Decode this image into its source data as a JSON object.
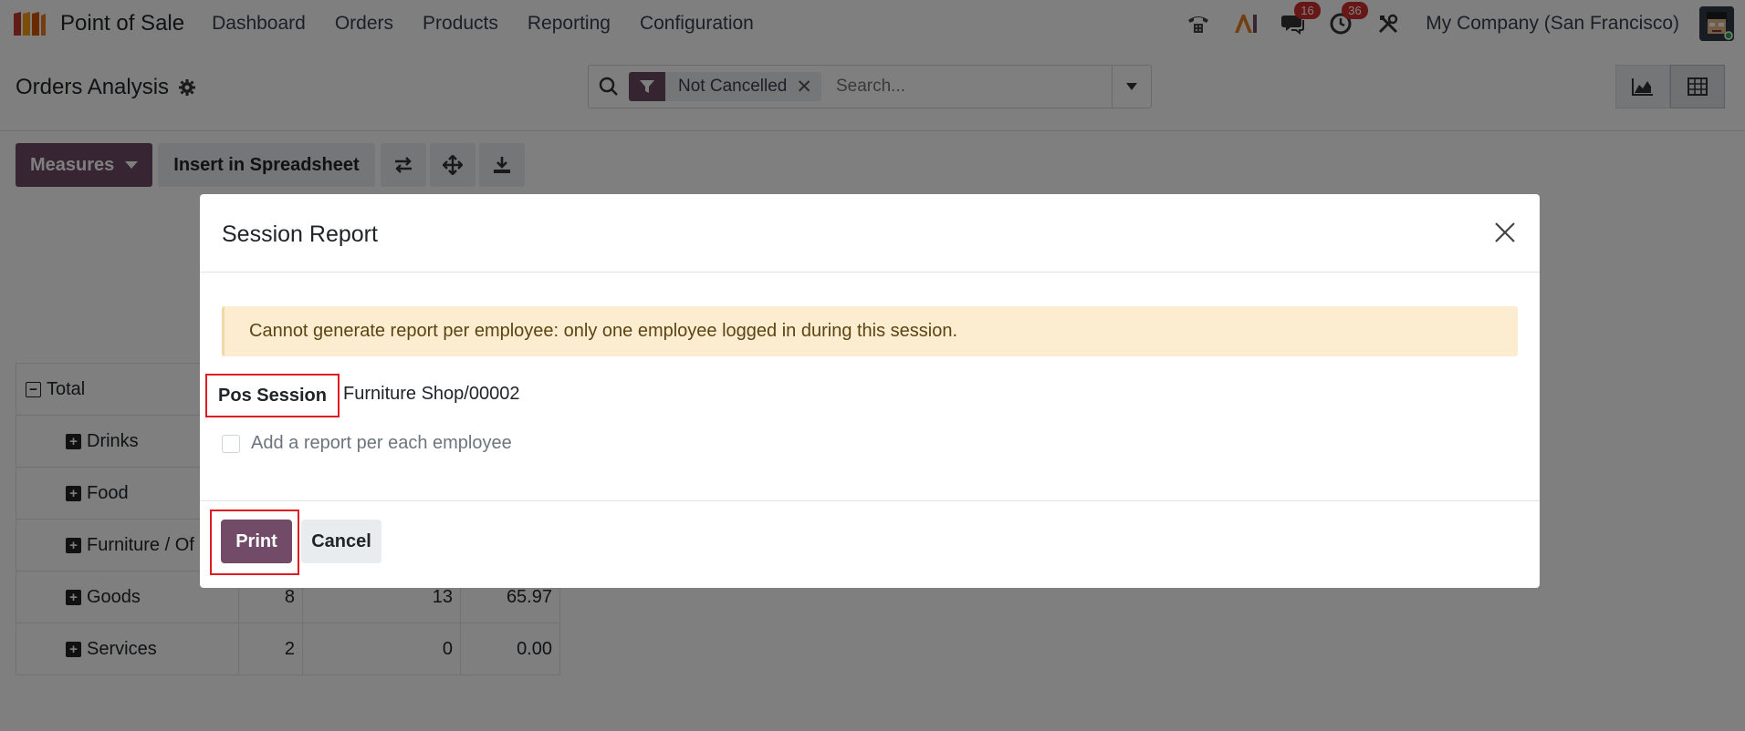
{
  "navbar": {
    "app_name": "Point of Sale",
    "menu": [
      "Dashboard",
      "Orders",
      "Products",
      "Reporting",
      "Configuration"
    ],
    "messages_badge": "16",
    "activities_badge": "36",
    "company": "My Company (San Francisco)",
    "icons": [
      "phone-icon",
      "ai-icon",
      "chat-icon",
      "clock-icon",
      "tools-icon"
    ]
  },
  "control_panel": {
    "title": "Orders Analysis",
    "search": {
      "facet": "Not Cancelled",
      "placeholder": "Search..."
    }
  },
  "toolbar": {
    "measures_label": "Measures",
    "insert_label": "Insert in Spreadsheet"
  },
  "pivot": {
    "total_label": "Total",
    "rows": [
      {
        "label": "Drinks",
        "values": [
          "",
          "",
          ""
        ]
      },
      {
        "label": "Food",
        "values": [
          "",
          "",
          ""
        ]
      },
      {
        "label": "Furniture / Of",
        "values": [
          "",
          "",
          ""
        ]
      },
      {
        "label": "Goods",
        "values": [
          "8",
          "13",
          "65.97"
        ]
      },
      {
        "label": "Services",
        "values": [
          "2",
          "0",
          "0.00"
        ]
      }
    ]
  },
  "modal": {
    "title": "Session Report",
    "alert": "Cannot generate report per employee: only one employee logged in during this session.",
    "field_label": "Pos Session",
    "field_value": "Furniture Shop/00002",
    "checkbox_label": "Add a report per each employee",
    "print_label": "Print",
    "cancel_label": "Cancel"
  },
  "colors": {
    "primary": "#714b67",
    "alert_bg": "#fcecd0",
    "badge": "#d12f2f",
    "highlight": "#e01b24"
  }
}
